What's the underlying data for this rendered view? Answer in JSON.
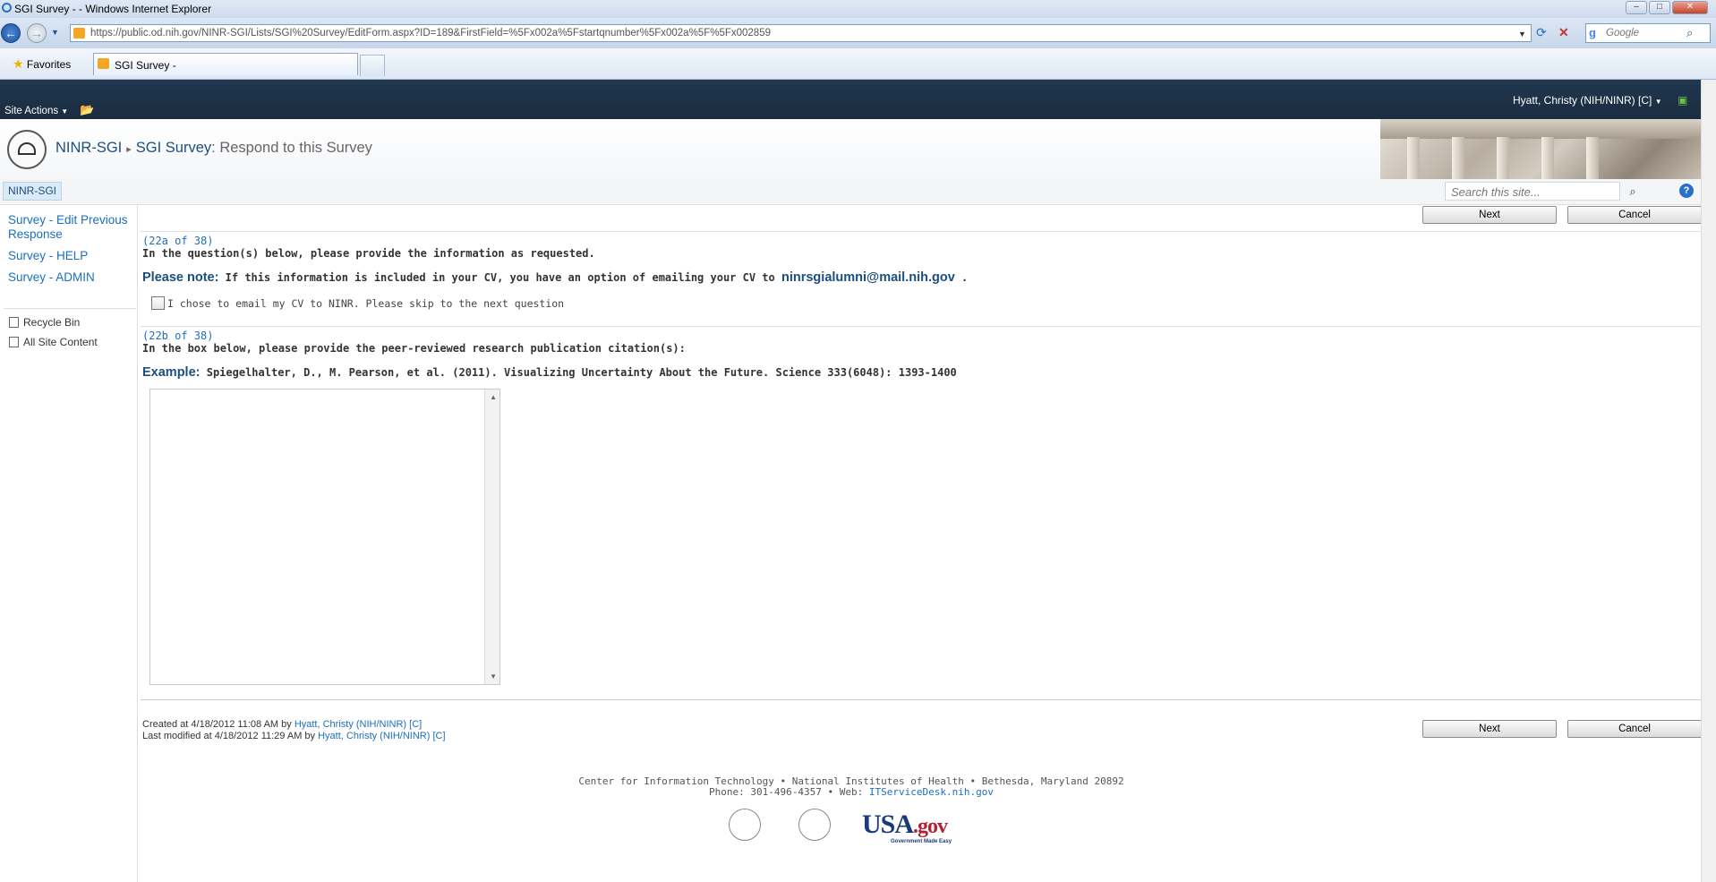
{
  "browser": {
    "window_title": "SGI Survey - - Windows Internet Explorer",
    "url": "https://public.od.nih.gov/NINR-SGI/Lists/SGI%20Survey/EditForm.aspx?ID=189&FirstField=%5Fx002a%5Fstartqnumber%5Fx002a%5F%5Fx002859",
    "search_placeholder": "Google",
    "favorites_label": "Favorites",
    "tab_label": "SGI Survey -"
  },
  "ribbon": {
    "site_actions": "Site Actions",
    "user": "Hyatt, Christy (NIH/NINR) [C]"
  },
  "title_area": {
    "site": "NINR-SGI",
    "list": "SGI Survey",
    "page": ": Respond to this Survey"
  },
  "top_nav": {
    "tab": "NINR-SGI",
    "search_placeholder": "Search this site..."
  },
  "left_nav": {
    "links": [
      "Survey - Edit Previous Response",
      "Survey - HELP",
      "Survey - ADMIN"
    ],
    "tools": [
      "Recycle Bin",
      "All Site Content"
    ]
  },
  "buttons": {
    "next": "Next",
    "cancel": "Cancel"
  },
  "question_a": {
    "number": "(22a of 38)",
    "instruction": "In the question(s) below, please provide the information as requested.",
    "note_lead": "Please note:",
    "note_text": "If this information is included in your CV, you have an option of emailing your CV to",
    "note_email": "ninrsgialumni@mail.nih.gov",
    "note_end": ".",
    "checkbox_label": "I chose to email my CV to NINR. Please skip to the next question",
    "checked": false
  },
  "question_b": {
    "number": "(22b of 38)",
    "instruction": "In the box below, please provide the peer-reviewed research publication citation(s):",
    "example_lead": "Example:",
    "example_text": "Spiegelhalter, D., M. Pearson, et al. (2011). Visualizing Uncertainty About the Future. Science 333(6048): 1393-1400",
    "answer": ""
  },
  "meta": {
    "created_prefix": "Created at 4/18/2012 11:08 AM by",
    "created_by": "Hyatt, Christy (NIH/NINR) [C]",
    "modified_prefix": "Last modified at 4/18/2012 11:29 AM by",
    "modified_by": "Hyatt, Christy (NIH/NINR) [C]"
  },
  "footer": {
    "line1": "Center for Information Technology • National Institutes of Health • Bethesda, Maryland 20892",
    "line2_prefix": "Phone: 301-496-4357 • Web:",
    "line2_link": "ITServiceDesk.nih.gov",
    "usa_gov": "USA",
    "usa_gov_suffix": ".gov",
    "usa_tagline": "Government Made Easy"
  }
}
